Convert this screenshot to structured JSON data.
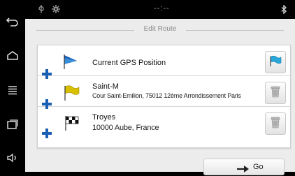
{
  "navbar": {
    "items": [
      {
        "name": "back-icon"
      },
      {
        "name": "home-icon"
      },
      {
        "name": "menu-icon"
      },
      {
        "name": "recent-apps-icon"
      },
      {
        "name": "volume-icon"
      }
    ]
  },
  "status": {
    "time": "--:--",
    "icons": [
      "usb-icon",
      "settings-icon",
      "bluetooth-icon"
    ]
  },
  "page": {
    "title": "Edit Route"
  },
  "route": {
    "points": [
      {
        "name": "Current GPS Position",
        "address": "",
        "icon": "gps-flag-icon",
        "action": "flag-icon"
      },
      {
        "name": "Saint-M",
        "address": "Cour Saint-Emilion, 75012 12ème Arrondissement Paris",
        "icon": "yellow-flag-icon",
        "action": "trash-icon"
      },
      {
        "name": "Troyes",
        "address": "10000 Aube, France",
        "icon": "checkered-flag-icon",
        "action": "trash-icon"
      }
    ]
  },
  "footer": {
    "go_label": "Go"
  },
  "colors": {
    "accent": "#1a5fb4",
    "flag_cyan": "#2aa6d8",
    "flag_yellow": "#d8c000"
  }
}
